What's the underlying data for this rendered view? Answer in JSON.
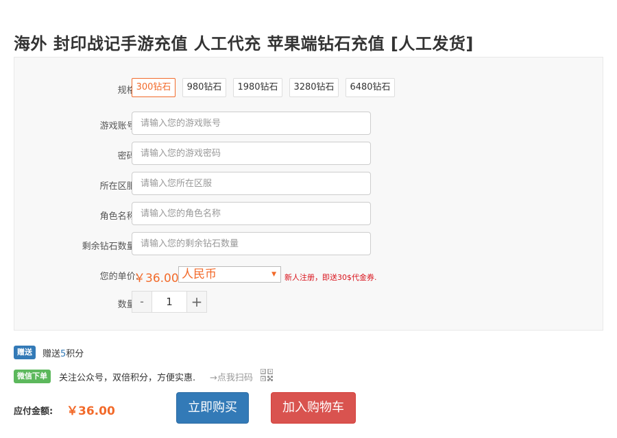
{
  "page": {
    "title": "海外 封印战记手游充值  人工代充 苹果端钻石充值 [人工发货]"
  },
  "form": {
    "spec_label": "规格:",
    "specs": [
      "300钻石",
      "980钻石",
      "1980钻石",
      "3280钻石",
      "6480钻石"
    ],
    "selected_spec": "300钻石",
    "fields": [
      {
        "label": "游戏账号:",
        "placeholder": "请输入您的游戏账号",
        "value": ""
      },
      {
        "label": "密码:",
        "placeholder": "请输入您的游戏密码",
        "value": ""
      },
      {
        "label": "所在区服:",
        "placeholder": "请输入您所在区服",
        "value": ""
      },
      {
        "label": "角色名称:",
        "placeholder": "请输入您的角色名称",
        "value": ""
      },
      {
        "label": "剩余钻石数量:",
        "placeholder": "请输入您的剩余钻石数量",
        "value": ""
      }
    ],
    "price_label": "您的单价:",
    "price": "￥36.00",
    "currency": {
      "selected": "人民币",
      "arrow": "▼"
    },
    "promo": "新人注册，即送30$代金券.",
    "quantity_label": "数量:",
    "quantity": "1",
    "minus": "-",
    "plus": "+"
  },
  "gift": {
    "badge": "赠送",
    "text_prefix": "赠送",
    "points": "5",
    "text_suffix": "积分"
  },
  "wechat": {
    "badge": "微信下单",
    "text": "关注公众号，双倍积分，方便实惠.",
    "scan_label": "→点我扫码",
    "icon": "qr-code-icon"
  },
  "checkout": {
    "label": "应付金额:",
    "amount": "￥36.00",
    "buy_label": "立即购买",
    "cart_label": "加入购物车"
  },
  "colors": {
    "accent": "#f26a2a",
    "primary": "#337ab7",
    "danger": "#d9534f",
    "success": "#5cb85c",
    "promo": "#d9121b"
  }
}
